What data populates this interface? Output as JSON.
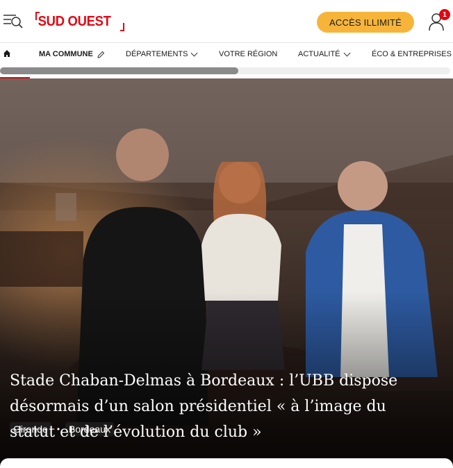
{
  "header": {
    "logo_text": "SUD OUEST",
    "cta_label": "ACCÈS ILLIMITÉ",
    "notification_count": "1",
    "icons": {
      "menu": "search-menu-icon",
      "account": "user-account-icon"
    }
  },
  "nav": {
    "items": [
      {
        "label": "",
        "icon": "home-icon"
      },
      {
        "label": "MA COMMUNE",
        "icon": "pencil-icon"
      },
      {
        "label": "DÉPARTEMENTS",
        "icon": "chevron-down-icon"
      },
      {
        "label": "VOTRE RÉGION"
      },
      {
        "label": "ACTUALITÉ",
        "icon": "chevron-down-icon"
      },
      {
        "label": "ÉCO & ENTREPRISES"
      }
    ],
    "scroll_progress": 0.53
  },
  "article": {
    "tags": [
      "Gironde",
      "Bordeaux"
    ],
    "headline": "Stade Chaban-Delmas à Bordeaux : l’UBB dispose désormais d’un salon présidentiel « à l’image du statut et de l’évolution du club »"
  },
  "colors": {
    "brand": "#e30613",
    "cta": "#f6b53a"
  }
}
